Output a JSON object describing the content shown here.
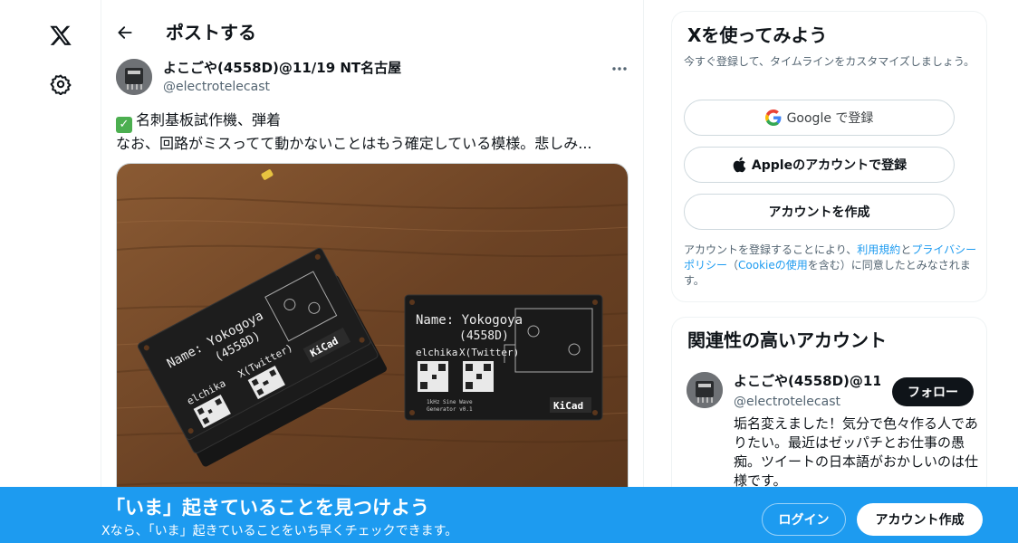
{
  "nav": {
    "logo_icon": "x-logo-icon",
    "settings_icon": "gear-icon"
  },
  "header": {
    "back_icon": "arrow-left-icon",
    "title": "ポストする"
  },
  "post": {
    "author_name": "よこごや(4558D)@11/19 NT名古屋",
    "author_handle": "@electrotelecast",
    "more_icon": "more-dots-icon",
    "text_line1": "名刺基板試作機、弾着",
    "text_line2": "なお、回路がミスってて動かないことはもう確定している模様。悲しみ...",
    "image": {
      "card1_name": "Name: Yokogoya",
      "card1_sub": "(4558D)",
      "card1_left_label": "elchika",
      "card1_right_label": "X(Twitter)",
      "card1_logo": "KiCad",
      "card2_name": "Name: Yokogoya",
      "card2_sub": "(4558D)",
      "card2_left_label": "elchika",
      "card2_right_label": "X(Twitter)",
      "card2_logo": "KiCad",
      "card2_small": "1kHz Sine Wave",
      "card2_small2": "Generator v0.1"
    }
  },
  "signup": {
    "title": "Xを使ってみよう",
    "desc": "今すぐ登録して、タイムラインをカスタマイズしましょう。",
    "google_label": "Google で登録",
    "apple_label": "Appleのアカウントで登録",
    "create_label": "アカウントを作成",
    "terms_prefix": "アカウントを登録することにより、",
    "terms_link1": "利用規約",
    "terms_and": "と",
    "terms_link2": "プライバシーポリシー",
    "terms_paren_open": "（",
    "terms_link3": "Cookieの使用",
    "terms_suffix": "を含む）に同意したとみなされます。"
  },
  "related": {
    "title": "関連性の高いアカウント",
    "name": "よこごや(4558D)@11/19 NT名古屋",
    "handle": "@electrotelecast",
    "follow_label": "フォロー",
    "bio": "垢名変えました！気分で色々作る人でありたい。最近はゼッパチとお仕事の愚痴。ツイートの日本語がおかしいのは仕様です。"
  },
  "banner": {
    "title": "「いま」起きていることを見つけよう",
    "subtitle": "Xなら、「いま」起きていることをいち早くチェックできます。",
    "login_label": "ログイン",
    "create_label": "アカウント作成",
    "bg_color": "#1d9bf0"
  }
}
